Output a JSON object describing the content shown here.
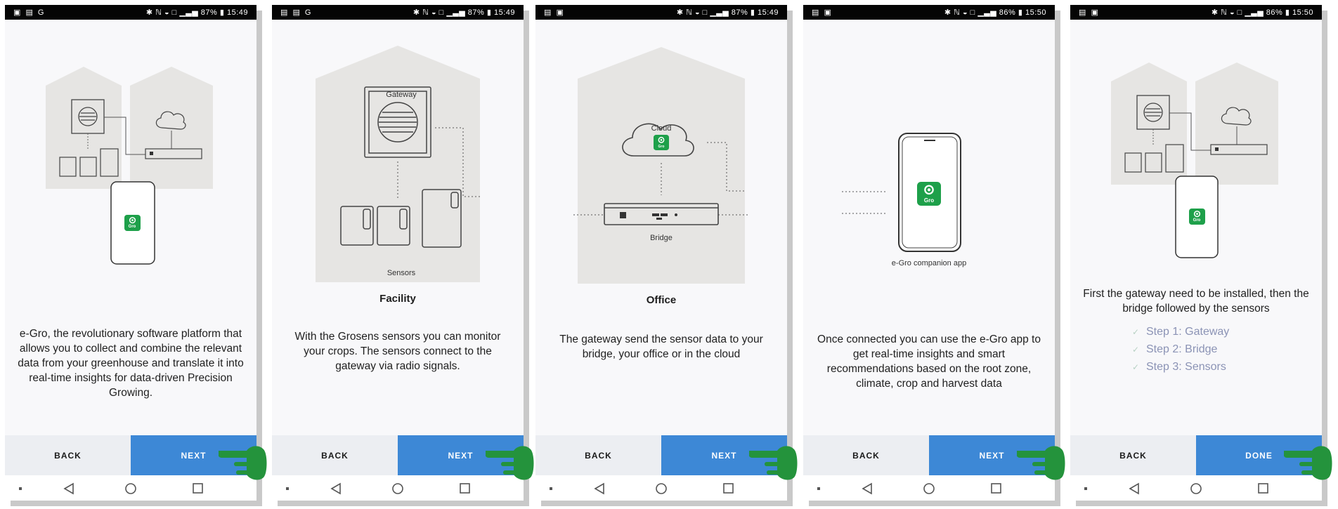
{
  "screens": [
    {
      "status_left": "▣ ▤ G",
      "status_right": "✱ ℕ ◒ □ ▁▃▅ 87% ▮ 15:49",
      "description": "e-Gro, the revolutionary software platform that allows you to collect and combine the relevant data from your greenhouse and translate it into real-time insights for data-driven Precision Growing.",
      "back": "BACK",
      "next": "NEXT"
    },
    {
      "status_left": "▤ ▤ G",
      "status_right": "✱ ℕ ◒ □ ▁▃▅ 87% ▮ 15:49",
      "labels": {
        "gateway": "Gateway",
        "sensors": "Sensors"
      },
      "caption": "Facility",
      "description": "With the Grosens sensors you can monitor your crops. The sensors connect to the gateway via radio signals.",
      "back": "BACK",
      "next": "NEXT"
    },
    {
      "status_left": "▤ ▣",
      "status_right": "✱ ℕ ◒ □ ▁▃▅ 87% ▮ 15:49",
      "labels": {
        "cloud": "Cloud",
        "bridge": "Bridge"
      },
      "caption": "Office",
      "description": "The gateway send the sensor data to your bridge, your office or in the cloud",
      "back": "BACK",
      "next": "NEXT"
    },
    {
      "status_left": "▤ ▣",
      "status_right": "✱ ℕ ◒ □ ▁▃▅ 86% ▮ 15:50",
      "labels": {
        "app": "e-Gro companion app"
      },
      "description": "Once connected you can use the e-Gro app to get real-time insights and smart recommendations based on the root zone, climate, crop and harvest data",
      "back": "BACK",
      "next": "NEXT"
    },
    {
      "status_left": "▤ ▣",
      "status_right": "✱ ℕ ◒ □ ▁▃▅ 86% ▮ 15:50",
      "description": "First the gateway need to be installed, then the bridge followed by the sensors",
      "steps": [
        "Step 1: Gateway",
        "Step 2: Bridge",
        "Step 3: Sensors"
      ],
      "back": "BACK",
      "next": "DONE"
    }
  ],
  "app_logo": "Gro",
  "colors": {
    "next_button": "#3d88d6",
    "back_button": "#eceef2",
    "logo_green": "#1ea04a",
    "hand_green": "#24933c",
    "steps_text": "#8b93b5",
    "house_fill": "#e6e5e3"
  }
}
